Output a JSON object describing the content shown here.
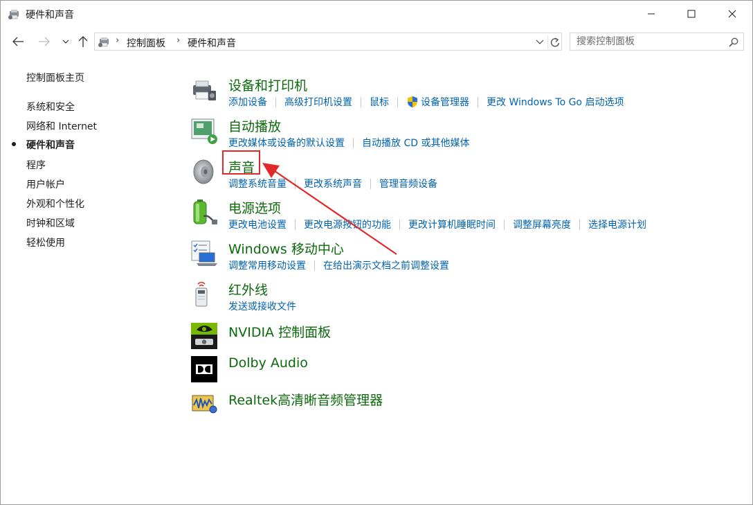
{
  "window": {
    "title": "硬件和声音",
    "controls": {
      "minimize": "minimize-icon",
      "maximize": "maximize-icon",
      "close": "close-icon"
    }
  },
  "address_bar": {
    "breadcrumbs": [
      "控制面板",
      "硬件和声音"
    ],
    "search_placeholder": "搜索控制面板"
  },
  "left_nav": {
    "items": [
      {
        "label": "控制面板主页",
        "active": false
      },
      {
        "label": "系统和安全",
        "active": false
      },
      {
        "label": "网络和 Internet",
        "active": false
      },
      {
        "label": "硬件和声音",
        "active": true
      },
      {
        "label": "程序",
        "active": false
      },
      {
        "label": "用户帐户",
        "active": false
      },
      {
        "label": "外观和个性化",
        "active": false
      },
      {
        "label": "时钟和区域",
        "active": false
      },
      {
        "label": "轻松使用",
        "active": false
      }
    ]
  },
  "categories": [
    {
      "title": "设备和打印机",
      "icon": "printer-icon",
      "links": [
        "添加设备",
        "高级打印机设置",
        "鼠标",
        "设备管理器",
        "更改 Windows To Go 启动选项"
      ]
    },
    {
      "title": "自动播放",
      "icon": "autoplay-icon",
      "links": [
        "更改媒体或设备的默认设置",
        "自动播放 CD 或其他媒体"
      ]
    },
    {
      "title": "声音",
      "icon": "speaker-icon",
      "links": [
        "调整系统音量",
        "更改系统声音",
        "管理音频设备"
      ]
    },
    {
      "title": "电源选项",
      "icon": "battery-icon",
      "links": [
        "更改电池设置",
        "更改电源按钮的功能",
        "更改计算机睡眠时间",
        "调整屏幕亮度",
        "选择电源计划"
      ]
    },
    {
      "title": "Windows 移动中心",
      "icon": "mobility-center-icon",
      "links": [
        "调整常用移动设置",
        "在给出演示文档之前调整设置"
      ]
    },
    {
      "title": "红外线",
      "icon": "infrared-icon",
      "links": [
        "发送或接收文件"
      ]
    },
    {
      "title": "NVIDIA 控制面板",
      "icon": "nvidia-icon",
      "links": []
    },
    {
      "title": "Dolby Audio",
      "icon": "dolby-icon",
      "links": []
    },
    {
      "title": "Realtek高清晰音频管理器",
      "icon": "realtek-icon",
      "links": []
    }
  ],
  "colors": {
    "category_title": "#0b6a0b",
    "link": "#0063b1",
    "annotation": "#e02a2a"
  }
}
